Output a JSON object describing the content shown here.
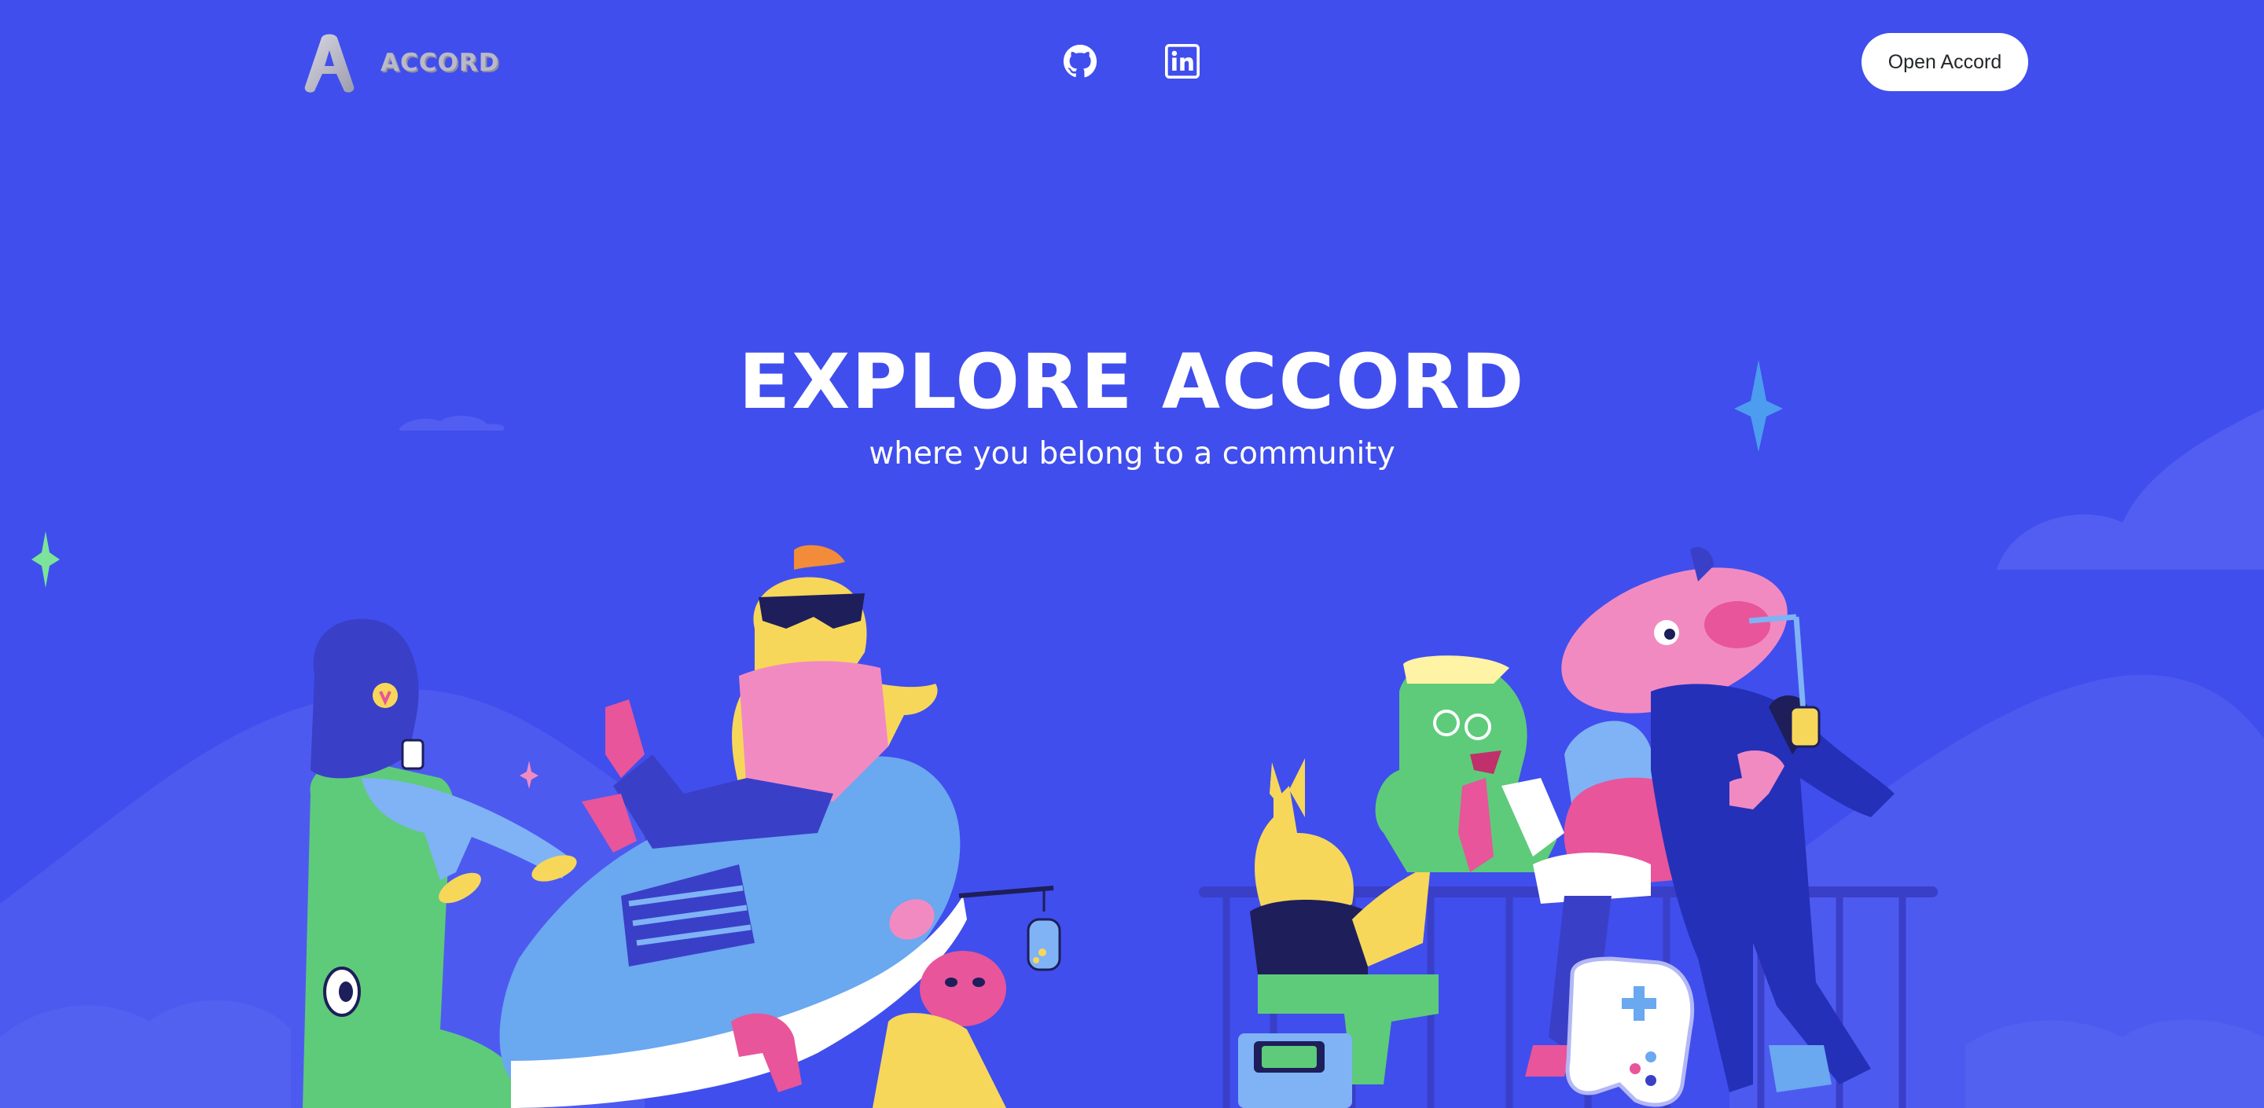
{
  "header": {
    "logo_text": "ACCORD",
    "open_button_label": "Open Accord"
  },
  "hero": {
    "title": "EXPLORE ACCORD",
    "subtitle": "where you belong to a community"
  },
  "icons": {
    "github": "github-icon",
    "linkedin": "linkedin-icon"
  },
  "colors": {
    "background": "#404EED",
    "button_bg": "#FFFFFF",
    "button_text": "#23272A",
    "accent_pink": "#E8559A",
    "accent_green": "#5ECB7A",
    "accent_yellow": "#F7D75A",
    "accent_blue": "#6AA8F0"
  }
}
